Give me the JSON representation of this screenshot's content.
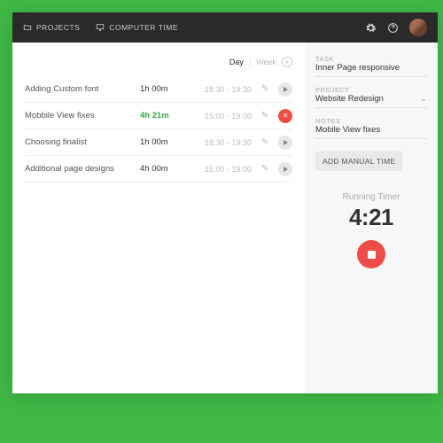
{
  "topbar": {
    "nav": {
      "projects": "PROJECTS",
      "computer_time": "COMPUTER TIME"
    }
  },
  "period": {
    "day": "Day",
    "week": "Week"
  },
  "entries": [
    {
      "name": "Adding Custom font",
      "duration": "1h 00m",
      "range": "18:30  -  19:30",
      "active": false
    },
    {
      "name": "Mobbile View fixes",
      "duration": "4h 21m",
      "range": "15:00  -  19:00",
      "active": true
    },
    {
      "name": "Choosing finalist",
      "duration": "1h 00m",
      "range": "18:30  -  19:30",
      "active": false
    },
    {
      "name": "Additional page designs",
      "duration": "4h 00m",
      "range": "15:00  -  19:00",
      "active": false
    }
  ],
  "side": {
    "task_label": "TASK",
    "task_value": "Inner Page responsive",
    "project_label": "PROJECT",
    "project_value": "Website Redesign",
    "notes_label": "NOTES",
    "notes_value": "Mobile View fixes",
    "add_manual": "ADD MANUAL TIME",
    "running_label": "Running Timer",
    "running_value": "4:21"
  },
  "colors": {
    "accent_green": "#3fb846",
    "accent_red": "#ef4c47"
  }
}
